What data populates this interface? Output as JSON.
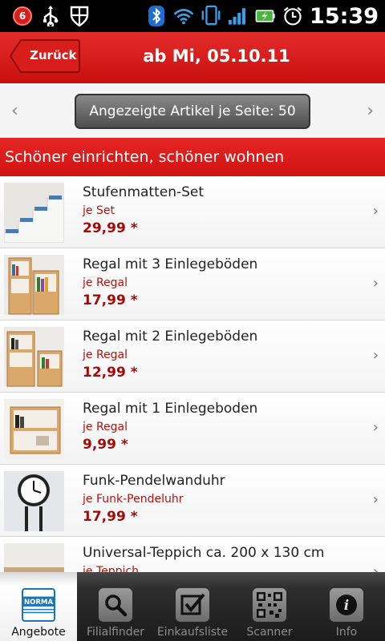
{
  "status_bar": {
    "notification_count": "6",
    "time": "15:39"
  },
  "header": {
    "back_label": "Zurück",
    "title": "ab Mi, 05.10.11"
  },
  "paging": {
    "per_page_label": "Angezeigte Artikel je Seite: 50"
  },
  "section": {
    "title": "Schöner einrichten, schöner wohnen"
  },
  "items": [
    {
      "name": "Stufenmatten-Set",
      "unit": "je Set",
      "price": "29,99 *"
    },
    {
      "name": "Regal mit 3 Einlegeböden",
      "unit": "je Regal",
      "price": "17,99 *"
    },
    {
      "name": "Regal mit 2 Einlegeböden",
      "unit": "je Regal",
      "price": "12,99 *"
    },
    {
      "name": "Regal mit 1 Einlegeboden",
      "unit": "je Regal",
      "price": "9,99 *"
    },
    {
      "name": "Funk-Pendelwanduhr",
      "unit": "je Funk-Pendeluhr",
      "price": "17,99 *"
    },
    {
      "name": "Universal-Teppich ca. 200 x 130 cm",
      "unit": "je Teppich",
      "price": ""
    }
  ],
  "tabs": [
    {
      "label": "Angebote",
      "icon": "norma-logo-icon",
      "logo_text": "NORMA"
    },
    {
      "label": "Filialfinder",
      "icon": "search-icon"
    },
    {
      "label": "Einkaufsliste",
      "icon": "checkbox-icon"
    },
    {
      "label": "Scanner",
      "icon": "qr-code-icon"
    },
    {
      "label": "Info",
      "icon": "info-icon"
    }
  ],
  "colors": {
    "brand_red": "#d4201c",
    "price_red": "#9e0d0a",
    "tab_active_blue": "#1c74b8"
  }
}
